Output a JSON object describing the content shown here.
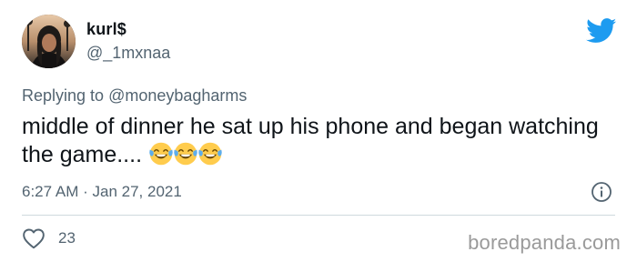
{
  "tweet": {
    "display_name": "kurl$",
    "handle": "@_1mxnaa",
    "reply_prefix": "Replying to",
    "reply_mention": "@moneybagharms",
    "text": "middle of dinner he sat up his phone and began watching the game.... ",
    "emojis": [
      "face-with-tears-of-joy",
      "face-with-tears-of-joy",
      "face-with-tears-of-joy"
    ],
    "time": "6:27 AM",
    "separator": "·",
    "date": "Jan 27, 2021",
    "like_count": "23"
  },
  "icons": {
    "platform": "twitter-bird-icon",
    "info": "info-icon",
    "like": "heart-icon"
  },
  "watermark": "boredpanda.com",
  "colors": {
    "brand": "#1d9bf0",
    "text_primary": "#0f1419",
    "text_secondary": "#536471",
    "divider": "#cfd9de",
    "emoji_face": "#ffcc4d",
    "emoji_tears": "#5dadec"
  }
}
